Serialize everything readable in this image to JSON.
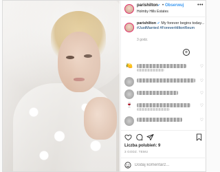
{
  "header": {
    "username": "parishilton",
    "verified_mark": "✔",
    "separator": "•",
    "follow_label": "Obserwuj",
    "location": "Holmby Hills Estates",
    "more_label": "•••"
  },
  "caption": {
    "username": "parishilton",
    "verified_mark": "✔",
    "text": " My forever begins today... ",
    "hashtags": "#JustMarried #ForeverHiltonReum",
    "time": "3 godz."
  },
  "load_more_label": "+",
  "comments": [
    {
      "avatar": "emoji-avatar",
      "emoji": "🍋"
    },
    {
      "avatar": "photo-avatar",
      "emoji": ""
    },
    {
      "avatar": "photo-avatar",
      "emoji": ""
    },
    {
      "avatar": "emoji-avatar",
      "emoji": "🍷"
    },
    {
      "avatar": "photo-avatar",
      "emoji": ""
    }
  ],
  "actions": {
    "icons": [
      "heart-icon",
      "comment-icon",
      "share-icon",
      "bookmark-icon"
    ]
  },
  "likes_label": "Liczba polubień: 9",
  "date": "3 GODZ. TEMU",
  "add_comment": {
    "placeholder": "Dodaj komentarz..."
  },
  "colors": {
    "link_blue": "#3897f0",
    "text": "#262626",
    "muted": "#8e8e8e",
    "border": "#dbdbdb"
  }
}
